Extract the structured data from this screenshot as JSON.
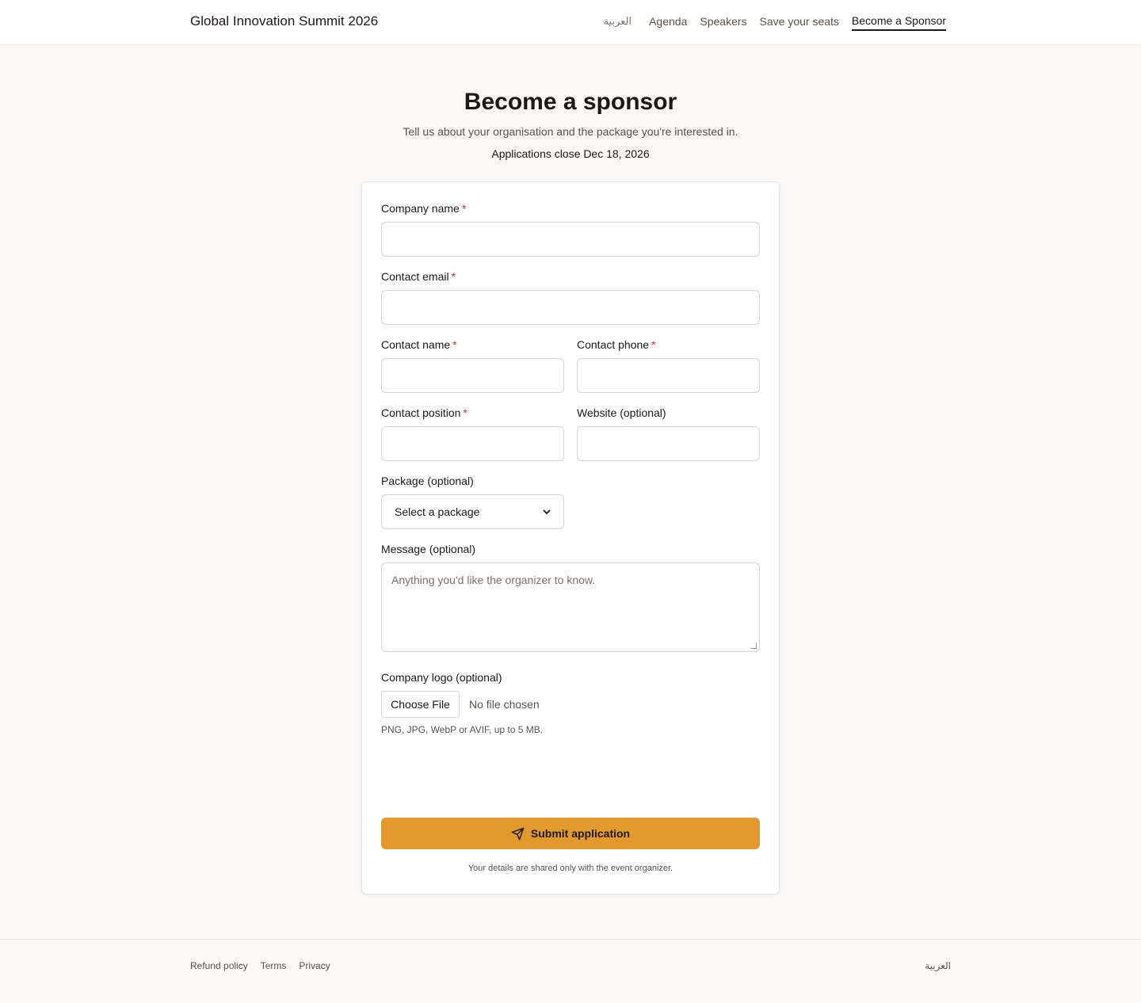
{
  "header": {
    "brand": "Global Innovation Summit 2026",
    "nav": {
      "lang": "العربية",
      "agenda": "Agenda",
      "speakers": "Speakers",
      "seats": "Save your seats",
      "sponsor": "Become a Sponsor"
    }
  },
  "hero": {
    "title": "Become a sponsor",
    "subtitle": "Tell us about your organisation and the package you're interested in.",
    "deadline": "Applications close Dec 18, 2026"
  },
  "form": {
    "company_name": {
      "label": "Company name",
      "required": "*",
      "value": ""
    },
    "contact_email": {
      "label": "Contact email",
      "required": "*",
      "value": ""
    },
    "contact_name": {
      "label": "Contact name",
      "required": "*",
      "value": ""
    },
    "contact_phone": {
      "label": "Contact phone",
      "required": "*",
      "value": ""
    },
    "contact_position": {
      "label": "Contact position",
      "required": "*",
      "value": ""
    },
    "website": {
      "label": "Website (optional)",
      "value": ""
    },
    "package": {
      "label": "Package (optional)",
      "selected": "Select a package"
    },
    "message": {
      "label": "Message (optional)",
      "placeholder": "Anything you'd like the organizer to know."
    },
    "logo": {
      "label": "Company logo (optional)",
      "button": "Choose File",
      "status": "No file chosen",
      "hint": "PNG, JPG, WebP or AVIF, up to 5 MB."
    },
    "submit_label": "Submit application",
    "privacy_note": "Your details are shared only with the event organizer."
  },
  "footer": {
    "links": {
      "refund": "Refund policy",
      "terms": "Terms",
      "privacy": "Privacy"
    },
    "lang": "العربية"
  },
  "colors": {
    "accent": "#e39a2d",
    "required": "#dc2626"
  },
  "icons": {
    "submit": "send-icon",
    "select": "chevron-down-icon"
  }
}
